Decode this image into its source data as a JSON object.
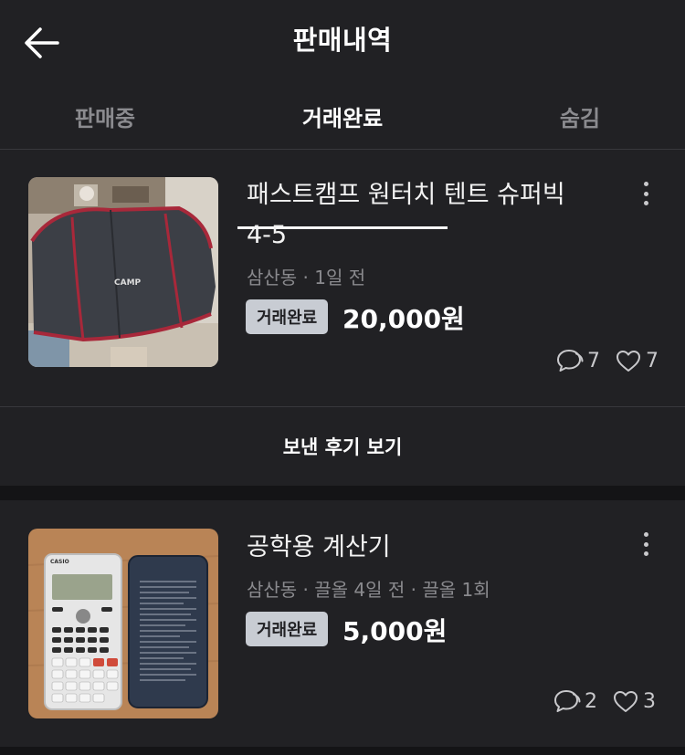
{
  "header": {
    "title": "판매내역",
    "back_icon": "arrow-left-icon"
  },
  "tabs": [
    {
      "label": "판매중",
      "active": false
    },
    {
      "label": "거래완료",
      "active": true
    },
    {
      "label": "숨김",
      "active": false
    }
  ],
  "items": [
    {
      "title_line1": "패스트캠프 원터치 텐트 슈퍼빅",
      "title_line2": "4-5",
      "meta": "삼산동 · 1일 전",
      "badge": "거래완료",
      "price": "20,000원",
      "chat_count": "7",
      "like_count": "7",
      "thumb_text": "CAMP"
    },
    {
      "title_line1": "공학용 계산기",
      "meta": "삼산동 · 끌올 4일 전 · 끌올 1회",
      "badge": "거래완료",
      "price": "5,000원",
      "chat_count": "2",
      "like_count": "3",
      "thumb_text": "CASIO"
    }
  ],
  "review_button": "보낸 후기 보기",
  "colors": {
    "background": "#212124",
    "badge_bg": "#c8ccd3",
    "muted": "#8a8a8e"
  }
}
